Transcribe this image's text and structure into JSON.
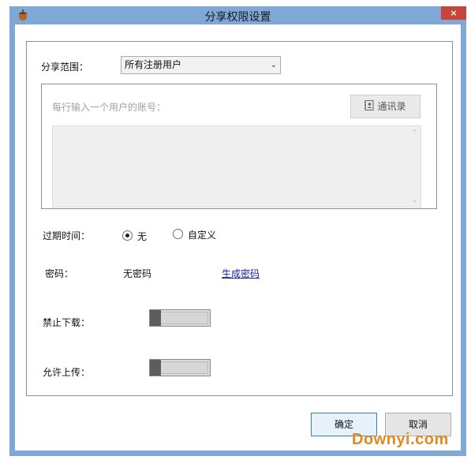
{
  "window": {
    "title": "分享权限设置",
    "close_label": "×"
  },
  "share_scope": {
    "label": "分享范围：",
    "selected": "所有注册用户"
  },
  "accounts": {
    "hint": "每行输入一个用户的账号：",
    "contacts_button": "通讯录"
  },
  "expiry": {
    "label": "过期时间：",
    "options": [
      {
        "label": "无",
        "checked": true
      },
      {
        "label": "自定义",
        "checked": false
      }
    ]
  },
  "password": {
    "label": "密码：",
    "value": "无密码",
    "generate_link": "生成密码"
  },
  "disable_download": {
    "label": "禁止下载："
  },
  "allow_upload": {
    "label": "允许上传："
  },
  "buttons": {
    "ok": "确定",
    "cancel": "取消"
  },
  "watermark": "Downyi.com",
  "colors": {
    "frame": "#7fa7d8",
    "close": "#c8453c",
    "link": "#1a1aa6",
    "watermark": "#e08a1e"
  }
}
